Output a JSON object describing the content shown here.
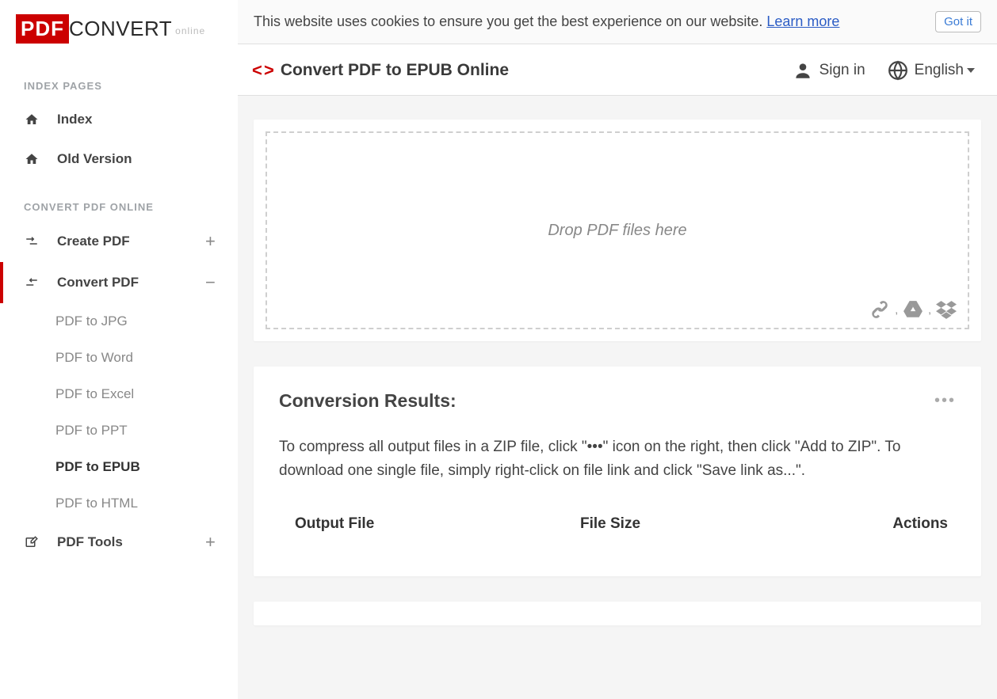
{
  "logo": {
    "pdf": "PDF",
    "convert": "CONVERT",
    "online": "online"
  },
  "cookie": {
    "text": "This website uses cookies to ensure you get the best experience on our website. ",
    "learn_more": "Learn more",
    "got_it": "Got it"
  },
  "sidebar": {
    "section_index": "INDEX PAGES",
    "index": "Index",
    "old_version": "Old Version",
    "section_convert": "CONVERT PDF ONLINE",
    "create_pdf": "Create PDF",
    "convert_pdf": "Convert PDF",
    "sub": {
      "jpg": "PDF to JPG",
      "word": "PDF to Word",
      "excel": "PDF to Excel",
      "ppt": "PDF to PPT",
      "epub": "PDF to EPUB",
      "html": "PDF to HTML"
    },
    "pdf_tools": "PDF Tools"
  },
  "topbar": {
    "title": "Convert PDF to EPUB Online",
    "sign_in": "Sign in",
    "language": "English"
  },
  "dropzone": {
    "text": "Drop PDF files here"
  },
  "results": {
    "title": "Conversion Results:",
    "description": "To compress all output files in a ZIP file, click \"•••\" icon on the right, then click \"Add to ZIP\". To download one single file, simply right-click on file link and click \"Save link as...\".",
    "col_output": "Output File",
    "col_size": "File Size",
    "col_actions": "Actions"
  }
}
